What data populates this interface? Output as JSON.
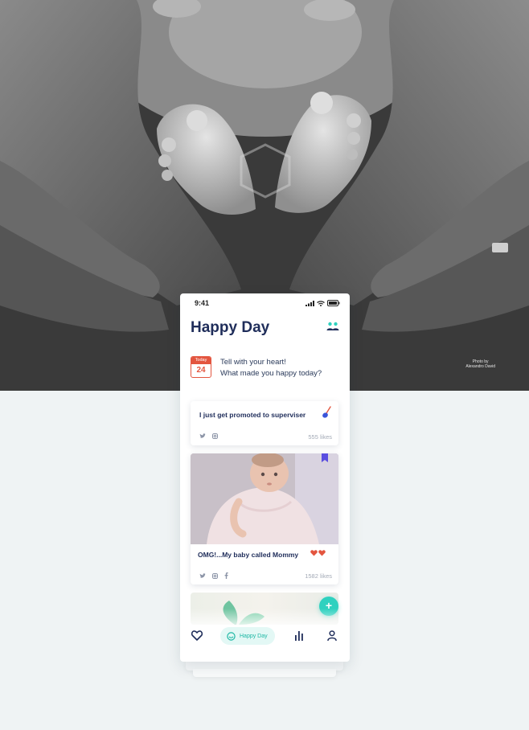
{
  "hero": {
    "credit_line1": "Photo by",
    "credit_line2": "Alexandro David"
  },
  "status_bar": {
    "time": "9:41"
  },
  "header": {
    "title": "Happy Day",
    "people_icon": "people-icon"
  },
  "prompt": {
    "calendar_label": "Today",
    "calendar_day": "24",
    "line1": "Tell with your heart!",
    "line2": "What made you happy today?"
  },
  "posts": [
    {
      "title": "I just get promoted to superviser",
      "emoji_icon": "spoon-icon",
      "social": [
        "twitter-icon",
        "instagram-icon"
      ],
      "likes": "555 likes"
    },
    {
      "title": "OMG!...My baby called Mommy",
      "emoji_icon": "hearts",
      "social": [
        "twitter-icon",
        "instagram-icon",
        "facebook-icon"
      ],
      "likes": "1582 likes"
    }
  ],
  "fab": {
    "label": "+"
  },
  "nav": {
    "items": [
      {
        "name": "heart-icon"
      },
      {
        "name": "happy-day",
        "label": "Happy Day"
      },
      {
        "name": "stats-icon"
      },
      {
        "name": "user-icon"
      }
    ]
  },
  "colors": {
    "primary_text": "#1f2d5a",
    "accent_teal": "#2fd1bf",
    "calendar_red": "#e3553f",
    "background": "#eff3f4"
  }
}
